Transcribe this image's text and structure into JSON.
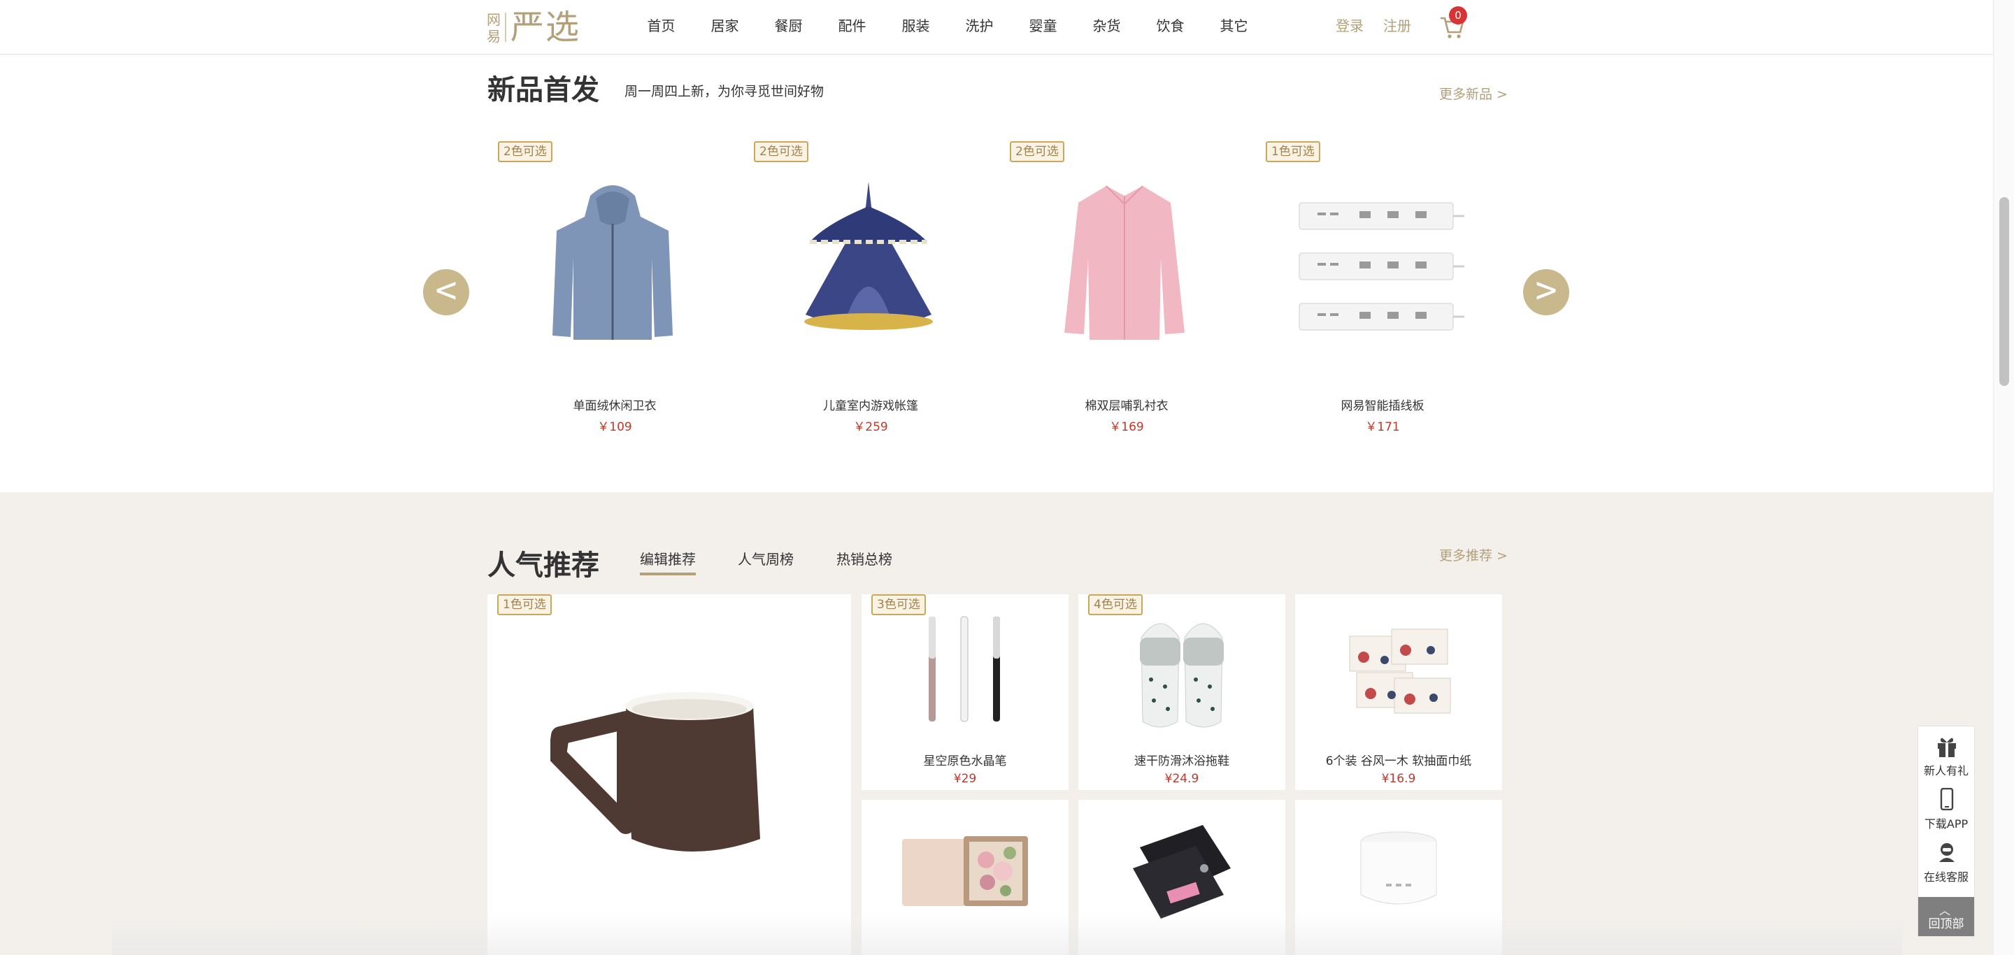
{
  "header": {
    "logo_small": "网易",
    "logo_big": "严选",
    "nav": [
      "首页",
      "居家",
      "餐厨",
      "配件",
      "服装",
      "洗护",
      "婴童",
      "杂货",
      "饮食",
      "其它"
    ],
    "login": "登录",
    "register": "注册",
    "cart_count": "0"
  },
  "new_products": {
    "title": "新品首发",
    "subtitle": "周一周四上新，为你寻觅世间好物",
    "more": "更多新品 >",
    "prev": "<",
    "next": ">",
    "items": [
      {
        "tag": "2色可选",
        "name": "单面绒休闲卫衣",
        "price": "￥109",
        "icon": "hoodie-image"
      },
      {
        "tag": "2色可选",
        "name": "儿童室内游戏帐篷",
        "price": "￥259",
        "icon": "tent-image"
      },
      {
        "tag": "2色可选",
        "name": "棉双层哺乳衬衣",
        "price": "￥169",
        "icon": "shirt-image"
      },
      {
        "tag": "1色可选",
        "name": "网易智能插线板",
        "price": "￥171",
        "icon": "power-strip-image"
      }
    ]
  },
  "popular": {
    "title": "人气推荐",
    "tabs": [
      "编辑推荐",
      "人气周榜",
      "热销总榜"
    ],
    "more": "更多推荐 >",
    "featured": {
      "tag": "1色可选",
      "icon": "mug-image"
    },
    "items": [
      {
        "tag": "3色可选",
        "name": "星空原色水晶笔",
        "price": "¥29",
        "icon": "pens-image"
      },
      {
        "tag": "4色可选",
        "name": "速干防滑沐浴拖鞋",
        "price": "¥24.9",
        "icon": "slippers-image"
      },
      {
        "tag": "",
        "name": "6个装 谷风一木 软抽面巾纸",
        "price": "¥16.9",
        "icon": "tissues-image"
      },
      {
        "tag": "",
        "name": "",
        "price": "",
        "icon": "flower-book-image"
      },
      {
        "tag": "",
        "name": "",
        "price": "",
        "icon": "black-gift-box-image"
      },
      {
        "tag": "",
        "name": "",
        "price": "",
        "icon": "humidifier-image"
      }
    ]
  },
  "side_tools": {
    "gift": "新人有礼",
    "app": "下载APP",
    "service": "在线客服",
    "top": "回顶部"
  },
  "colors": {
    "accent": "#b4a078",
    "price": "#c0392b",
    "section_bg": "#f3f0ec",
    "tag_border": "#c8a85a"
  }
}
